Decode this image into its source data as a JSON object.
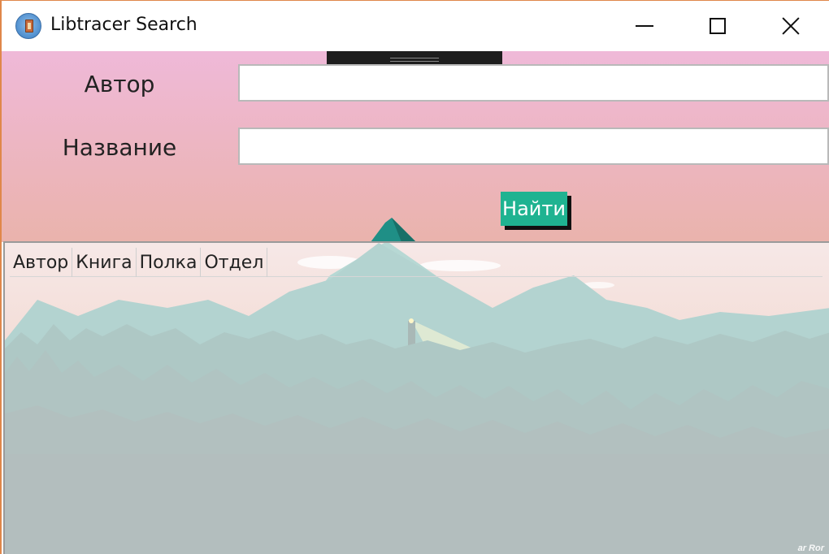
{
  "window": {
    "title": "Libtracer Search"
  },
  "form": {
    "author_label": "Автор",
    "title_label": "Название",
    "author_value": "",
    "title_value": "",
    "search_button_label": "Найти"
  },
  "table": {
    "columns": [
      "Автор",
      "Книга",
      "Полка",
      "Отдел"
    ]
  },
  "background": {
    "watermark": "ar Ror"
  },
  "colors": {
    "accent": "#1fb391",
    "form_top": "#efb9d8",
    "form_bottom": "#eab3ac"
  },
  "icons": [
    "app-book-icon",
    "minimize-icon",
    "maximize-icon",
    "close-icon",
    "drag-handle-icon"
  ]
}
